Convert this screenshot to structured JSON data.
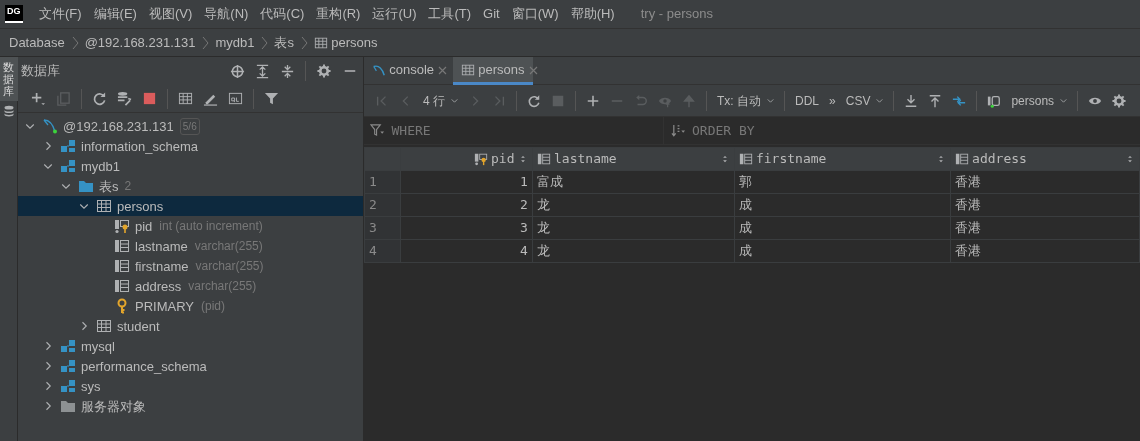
{
  "logo": "DG",
  "menu": [
    {
      "label": "文件(F)"
    },
    {
      "label": "编辑(E)"
    },
    {
      "label": "视图(V)"
    },
    {
      "label": "导航(N)"
    },
    {
      "label": "代码(C)"
    },
    {
      "label": "重构(R)"
    },
    {
      "label": "运行(U)"
    },
    {
      "label": "工具(T)"
    },
    {
      "label": "Git"
    },
    {
      "label": "窗口(W)"
    },
    {
      "label": "帮助(H)"
    }
  ],
  "window": {
    "title": "try - persons"
  },
  "breadcrumb": [
    {
      "label": "Database",
      "kind": "text"
    },
    {
      "label": "@192.168.231.131",
      "kind": "text"
    },
    {
      "label": "mydb1",
      "kind": "text"
    },
    {
      "label": "表s",
      "kind": "text"
    },
    {
      "label": "persons",
      "kind": "table"
    }
  ],
  "side_strip": {
    "label": "数据库"
  },
  "sidebar": {
    "title": "数据库",
    "tree": [
      {
        "name": "@192.168.231.131",
        "kind": "connection",
        "badge": "5/6",
        "expanded": true,
        "selected": false,
        "children": [
          {
            "name": "information_schema",
            "kind": "schema",
            "expanded": false,
            "selected": false
          },
          {
            "name": "mydb1",
            "kind": "schema",
            "expanded": true,
            "selected": false,
            "children": [
              {
                "name": "表s",
                "kind": "folder",
                "count": "2",
                "expanded": true,
                "selected": false,
                "children": [
                  {
                    "name": "persons",
                    "kind": "table",
                    "expanded": true,
                    "selected": true,
                    "children": [
                      {
                        "name": "pid",
                        "kind": "key-column",
                        "detail": "int (auto increment)",
                        "selected": false
                      },
                      {
                        "name": "lastname",
                        "kind": "column",
                        "detail": "varchar(255)",
                        "selected": false
                      },
                      {
                        "name": "firstname",
                        "kind": "column",
                        "detail": "varchar(255)",
                        "selected": false
                      },
                      {
                        "name": "address",
                        "kind": "column",
                        "detail": "varchar(255)",
                        "selected": false
                      },
                      {
                        "name": "PRIMARY",
                        "kind": "key",
                        "detail": "(pid)",
                        "selected": false
                      }
                    ]
                  },
                  {
                    "name": "student",
                    "kind": "table",
                    "expanded": false,
                    "selected": false
                  }
                ]
              }
            ]
          },
          {
            "name": "mysql",
            "kind": "schema",
            "expanded": false,
            "selected": false
          },
          {
            "name": "performance_schema",
            "kind": "schema",
            "expanded": false,
            "selected": false
          },
          {
            "name": "sys",
            "kind": "schema",
            "expanded": false,
            "selected": false
          },
          {
            "name": "服务器对象",
            "kind": "objects",
            "expanded": false,
            "selected": false
          }
        ]
      }
    ]
  },
  "tabs": [
    {
      "label": "console",
      "kind": "console",
      "selected": false
    },
    {
      "label": "persons",
      "kind": "table",
      "selected": true
    }
  ],
  "toolbar": {
    "page_size": "4 行",
    "transaction": "Tx: 自动",
    "ddl": "DDL",
    "more": "»",
    "export_format": "CSV",
    "target": "persons"
  },
  "filter": {
    "where": "WHERE",
    "order_by": "ORDER BY"
  },
  "table": {
    "columns": [
      {
        "label": "pid",
        "kind": "key"
      },
      {
        "label": "lastname",
        "kind": "column"
      },
      {
        "label": "firstname",
        "kind": "column"
      },
      {
        "label": "address",
        "kind": "column"
      }
    ],
    "rows": [
      {
        "number": "1",
        "cells": [
          "1",
          "富成",
          "郭",
          "香港"
        ]
      },
      {
        "number": "2",
        "cells": [
          "2",
          "龙",
          "成",
          "香港"
        ]
      },
      {
        "number": "3",
        "cells": [
          "3",
          "龙",
          "成",
          "香港"
        ]
      },
      {
        "number": "4",
        "cells": [
          "4",
          "龙",
          "成",
          "香港"
        ]
      }
    ]
  }
}
